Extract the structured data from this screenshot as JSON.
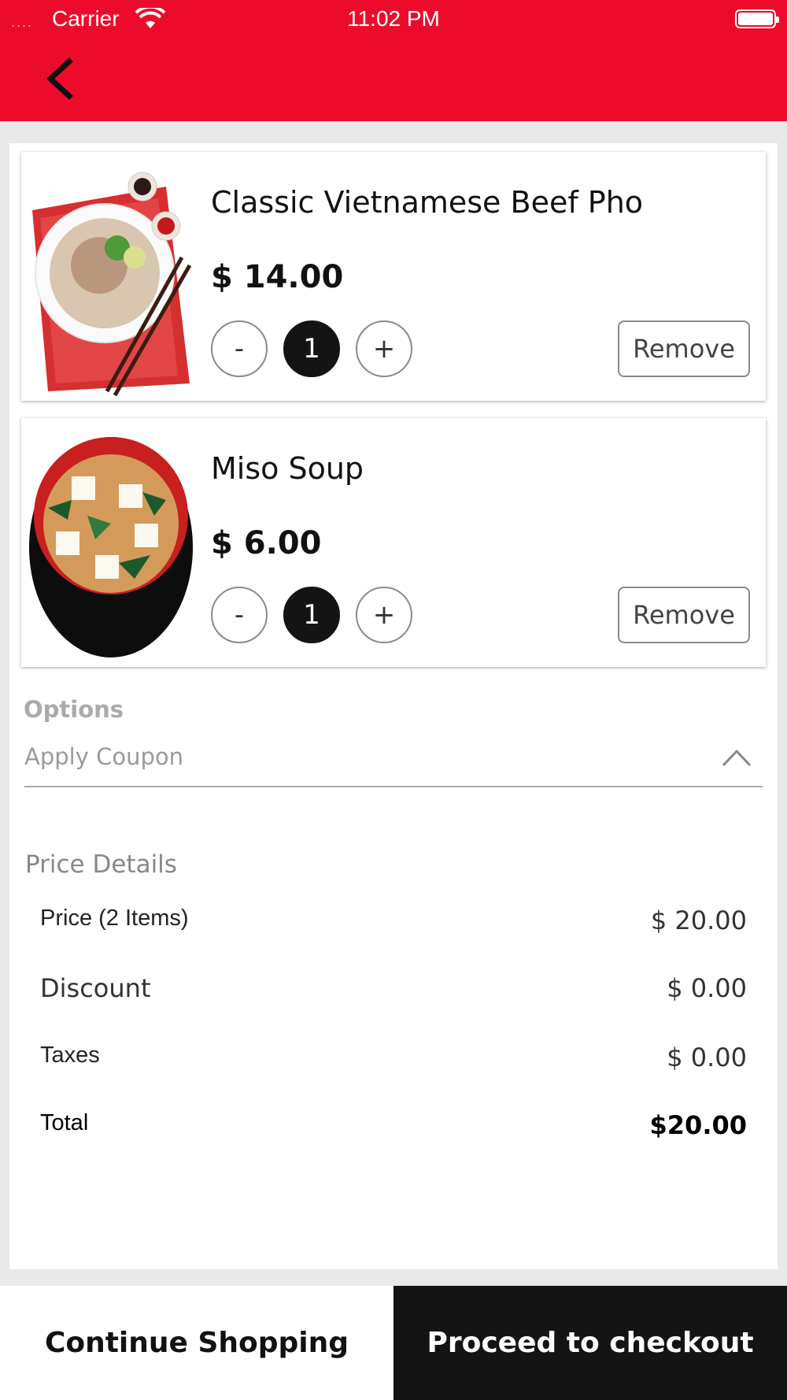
{
  "status_bar": {
    "signal": "....",
    "carrier": "Carrier",
    "time": "11:02 PM"
  },
  "colors": {
    "header": "#ed0b2c",
    "dark": "#141414"
  },
  "cart": {
    "items": [
      {
        "name": "Classic Vietnamese Beef Pho",
        "price": "$ 14.00",
        "quantity": "1",
        "minus": "-",
        "plus": "+",
        "remove": "Remove"
      },
      {
        "name": "Miso Soup",
        "price": "$ 6.00",
        "quantity": "1",
        "minus": "-",
        "plus": "+",
        "remove": "Remove"
      }
    ]
  },
  "options": {
    "label": "Options",
    "coupon_placeholder": "Apply Coupon"
  },
  "price_details": {
    "title": "Price Details",
    "rows": [
      {
        "label": "Price (2 Items)",
        "value": "$ 20.00"
      },
      {
        "label": "Discount",
        "value": "$ 0.00"
      },
      {
        "label": "Taxes",
        "value": "$ 0.00"
      },
      {
        "label": "Total",
        "value": "$20.00"
      }
    ]
  },
  "footer": {
    "continue": "Continue Shopping",
    "checkout": "Proceed to checkout"
  }
}
